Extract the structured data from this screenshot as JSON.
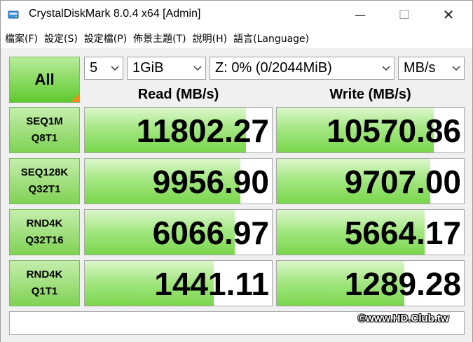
{
  "window": {
    "title": "CrystalDiskMark 8.0.4 x64 [Admin]",
    "icons": {
      "app": "disk-app-icon",
      "minimize": "minimize-icon",
      "maximize": "maximize-icon",
      "close": "close-icon"
    }
  },
  "menu": {
    "items": [
      "檔案(F)",
      "設定(S)",
      "設定檔(P)",
      "佈景主題(T)",
      "說明(H)",
      "語言(Language)"
    ]
  },
  "controls": {
    "all_label": "All",
    "count": "5",
    "size": "1GiB",
    "drive": "Z: 0% (0/2044MiB)",
    "unit": "MB/s"
  },
  "columns": {
    "read": "Read (MB/s)",
    "write": "Write (MB/s)"
  },
  "tests": [
    {
      "line1": "SEQ1M",
      "line2": "Q8T1",
      "read": "11802.27",
      "write": "10570.86",
      "read_fill": 0.86,
      "write_fill": 0.84
    },
    {
      "line1": "SEQ128K",
      "line2": "Q32T1",
      "read": "9956.90",
      "write": "9707.00",
      "read_fill": 0.83,
      "write_fill": 0.82
    },
    {
      "line1": "RND4K",
      "line2": "Q32T16",
      "read": "6066.97",
      "write": "5664.17",
      "read_fill": 0.8,
      "write_fill": 0.79
    },
    {
      "line1": "RND4K",
      "line2": "Q1T1",
      "read": "1441.11",
      "write": "1289.28",
      "read_fill": 0.69,
      "write_fill": 0.68
    }
  ],
  "comment": "",
  "watermark": "©www.HD.Club.tw",
  "colors": {
    "accent_green": "#79d64c",
    "corner_orange": "#f28a1a"
  }
}
